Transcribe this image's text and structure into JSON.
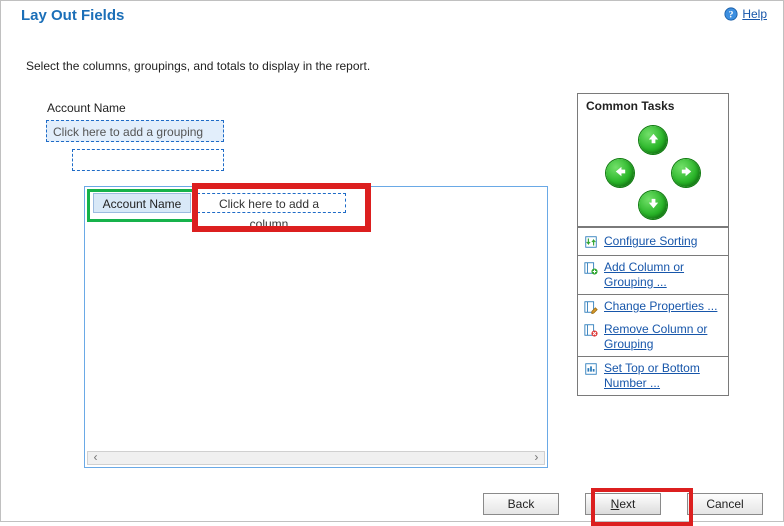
{
  "header": {
    "title": "Lay Out Fields",
    "help_label": "Help"
  },
  "instruction": "Select the columns, groupings, and totals to display in the report.",
  "layout": {
    "grouping_label": "Account Name",
    "grouping_placeholder": "Click here to add a grouping",
    "columns": {
      "existing": "Account Name",
      "add_placeholder": "Click here to add a column"
    }
  },
  "tasks": {
    "heading": "Common Tasks",
    "arrows": {
      "up": "move-up",
      "down": "move-down",
      "left": "move-left",
      "right": "move-right"
    },
    "items": {
      "configure_sorting": "Configure Sorting",
      "add_column": "Add Column or Grouping ...",
      "change_props": "Change Properties ...",
      "remove": "Remove Column or Grouping",
      "set_top": "Set Top or Bottom Number ..."
    }
  },
  "buttons": {
    "back": "Back",
    "next": "Next",
    "cancel": "Cancel"
  },
  "colors": {
    "highlight_green": "#16b24b",
    "highlight_red": "#dc1f1f",
    "accent_blue": "#1b6fb8"
  }
}
